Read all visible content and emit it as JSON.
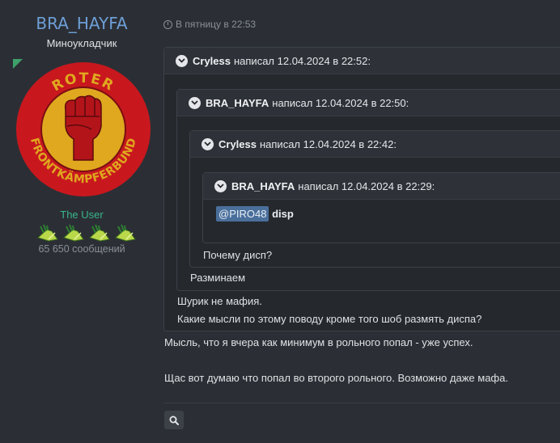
{
  "author": {
    "username": "BRA_HAYFA",
    "title": "Миноукладчик",
    "rank": "The User",
    "message_count": "65 650 сообщений",
    "avatar_text_top": "ROTER",
    "avatar_text_bottom": "FRONTKÄMPFERBUND",
    "badge_count": 4
  },
  "post": {
    "date": "В пятницу в 22:53",
    "quotes": [
      {
        "author": "Cryless",
        "said": "написал 12.04.2024 в 22:52:"
      },
      {
        "author": "BRA_HAYFA",
        "said": "написал 12.04.2024 в 22:50:"
      },
      {
        "author": "Cryless",
        "said": "написал 12.04.2024 в 22:42:"
      },
      {
        "author": "BRA_HAYFA",
        "said": "написал 12.04.2024 в 22:29:"
      }
    ],
    "innermost_mention": "@PIRO48",
    "innermost_text": "disp",
    "q3_text": "Почему дисп?",
    "q2_text": "Разминаем",
    "q1_line1": "Шурик не мафия.",
    "q1_line2": "Какие мысли по этому поводу кроме того шоб размять диспа?",
    "body_line1": "Мысль, что я вчера как минимум в рольного попал - уже успех.",
    "body_line2": "Щас вот думаю что попал во второго рольного. Возможно даже мафа."
  },
  "colors": {
    "username": "#6e9fd6",
    "rank": "#39b58a",
    "mention_bg": "#4a6f9b",
    "avatar_red": "#c8181e",
    "avatar_gold": "#e0a81e"
  }
}
